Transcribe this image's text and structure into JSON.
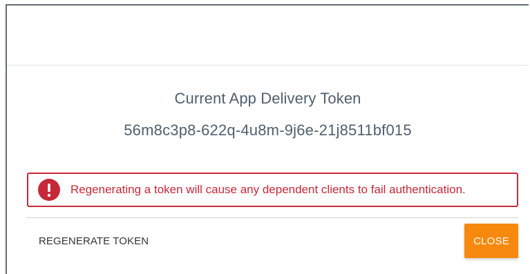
{
  "dialog": {
    "token_title": "Current App Delivery Token",
    "token_value": "56m8c3p8-622q-4u8m-9j6e-21j8511bf015",
    "warning": {
      "icon": "exclamation-circle-icon",
      "text": "Regenerating a token will cause any dependent clients to fail authentication."
    },
    "actions": {
      "regenerate_label": "REGENERATE TOKEN",
      "close_label": "CLOSE"
    }
  },
  "colors": {
    "title_text": "#4f5f6d",
    "warning_red": "#c62838",
    "close_orange": "#f7890f"
  }
}
